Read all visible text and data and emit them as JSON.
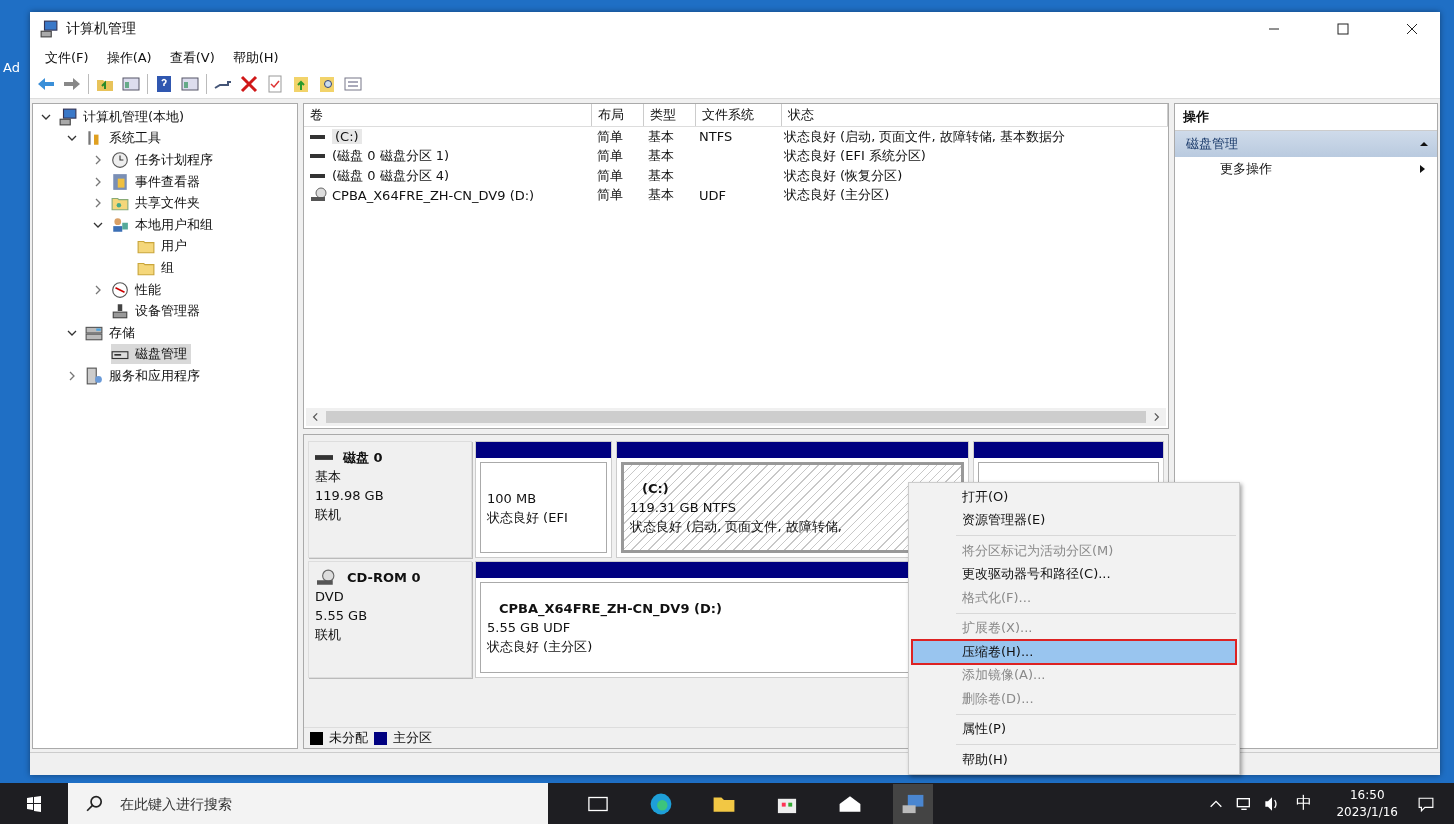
{
  "desktop": {
    "labels": [
      "Ad"
    ]
  },
  "window": {
    "title": "计算机管理"
  },
  "menu": [
    "文件(F)",
    "操作(A)",
    "查看(V)",
    "帮助(H)"
  ],
  "tree": [
    {
      "label": "计算机管理(本地)",
      "kind": "computer",
      "selected": false,
      "expanded": true,
      "children": [
        {
          "label": "系统工具",
          "kind": "tools",
          "selected": false,
          "expanded": true,
          "children": [
            {
              "label": "任务计划程序",
              "kind": "clock",
              "selected": false,
              "expanded": false
            },
            {
              "label": "事件查看器",
              "kind": "log",
              "selected": false,
              "expanded": false
            },
            {
              "label": "共享文件夹",
              "kind": "share",
              "selected": false,
              "expanded": false
            },
            {
              "label": "本地用户和组",
              "kind": "users",
              "selected": false,
              "expanded": true,
              "children": [
                {
                  "label": "用户",
                  "kind": "folder",
                  "selected": false
                },
                {
                  "label": "组",
                  "kind": "folder",
                  "selected": false
                }
              ]
            },
            {
              "label": "性能",
              "kind": "gauge",
              "selected": false,
              "expanded": false
            },
            {
              "label": "设备管理器",
              "kind": "device",
              "selected": false
            }
          ]
        },
        {
          "label": "存储",
          "kind": "storage",
          "selected": false,
          "expanded": true,
          "children": [
            {
              "label": "磁盘管理",
              "kind": "disk",
              "selected": true
            }
          ]
        },
        {
          "label": "服务和应用程序",
          "kind": "services",
          "selected": false,
          "expanded": false
        }
      ]
    }
  ],
  "volumes": {
    "columns": [
      "卷",
      "布局",
      "类型",
      "文件系统",
      "状态"
    ],
    "rows": [
      {
        "kind": "disk",
        "cells": [
          "(C:)",
          "简单",
          "基本",
          "NTFS",
          "状态良好 (启动, 页面文件, 故障转储, 基本数据分"
        ],
        "selected": true
      },
      {
        "kind": "disk",
        "cells": [
          "(磁盘 0 磁盘分区 1)",
          "简单",
          "基本",
          "",
          "状态良好 (EFI 系统分区)"
        ],
        "selected": false
      },
      {
        "kind": "disk",
        "cells": [
          "(磁盘 0 磁盘分区 4)",
          "简单",
          "基本",
          "",
          "状态良好 (恢复分区)"
        ],
        "selected": false
      },
      {
        "kind": "cd",
        "cells": [
          "CPBA_X64FRE_ZH-CN_DV9 (D:)",
          "简单",
          "基本",
          "UDF",
          "状态良好 (主分区)"
        ],
        "selected": false
      }
    ]
  },
  "disks": [
    {
      "kind": "disk",
      "name": "磁盘 0",
      "type": "基本",
      "size": "119.98 GB",
      "state": "联机",
      "partitions": [
        {
          "size": "100 MB",
          "status": "状态良好 (EFI",
          "selected": false
        },
        {
          "name": "(C:)",
          "size": "119.31 GB NTFS",
          "status": "状态良好 (启动, 页面文件, 故障转储,",
          "selected": true
        },
        {
          "selected": false
        }
      ]
    },
    {
      "kind": "cd",
      "name": "CD-ROM 0",
      "type": "DVD",
      "size": "5.55 GB",
      "state": "联机",
      "partitions": [
        {
          "name": "CPBA_X64FRE_ZH-CN_DV9  (D:)",
          "size": "5.55 GB UDF",
          "status": "状态良好 (主分区)",
          "selected": false
        }
      ]
    }
  ],
  "legend": [
    {
      "label": "未分配",
      "color": "#000000"
    },
    {
      "label": "主分区",
      "color": "#000080"
    }
  ],
  "actions": {
    "header": "操作",
    "section": "磁盘管理",
    "items": [
      "更多操作"
    ]
  },
  "context_menu": [
    {
      "kind": "item",
      "label": "打开(O)",
      "disabled": false,
      "selected": false,
      "annotated": false
    },
    {
      "kind": "item",
      "label": "资源管理器(E)",
      "disabled": false,
      "selected": false,
      "annotated": false
    },
    {
      "kind": "separator"
    },
    {
      "kind": "item",
      "label": "将分区标记为活动分区(M)",
      "disabled": true,
      "selected": false,
      "annotated": false
    },
    {
      "kind": "item",
      "label": "更改驱动器号和路径(C)...",
      "disabled": false,
      "selected": false,
      "annotated": false
    },
    {
      "kind": "item",
      "label": "格式化(F)...",
      "disabled": true,
      "selected": false,
      "annotated": false
    },
    {
      "kind": "separator"
    },
    {
      "kind": "item",
      "label": "扩展卷(X)...",
      "disabled": true,
      "selected": false,
      "annotated": false
    },
    {
      "kind": "item",
      "label": "压缩卷(H)...",
      "disabled": false,
      "selected": true,
      "annotated": true
    },
    {
      "kind": "item",
      "label": "添加镜像(A)...",
      "disabled": true,
      "selected": false,
      "annotated": false
    },
    {
      "kind": "item",
      "label": "删除卷(D)...",
      "disabled": true,
      "selected": false,
      "annotated": false
    },
    {
      "kind": "separator"
    },
    {
      "kind": "item",
      "label": "属性(P)",
      "disabled": false,
      "selected": false,
      "annotated": false
    },
    {
      "kind": "separator"
    },
    {
      "kind": "item",
      "label": "帮助(H)",
      "disabled": false,
      "selected": false,
      "annotated": false
    }
  ],
  "taskbar": {
    "search_placeholder": "在此键入进行搜索",
    "ime": "中",
    "time": "16:50",
    "date": "2023/1/16"
  }
}
